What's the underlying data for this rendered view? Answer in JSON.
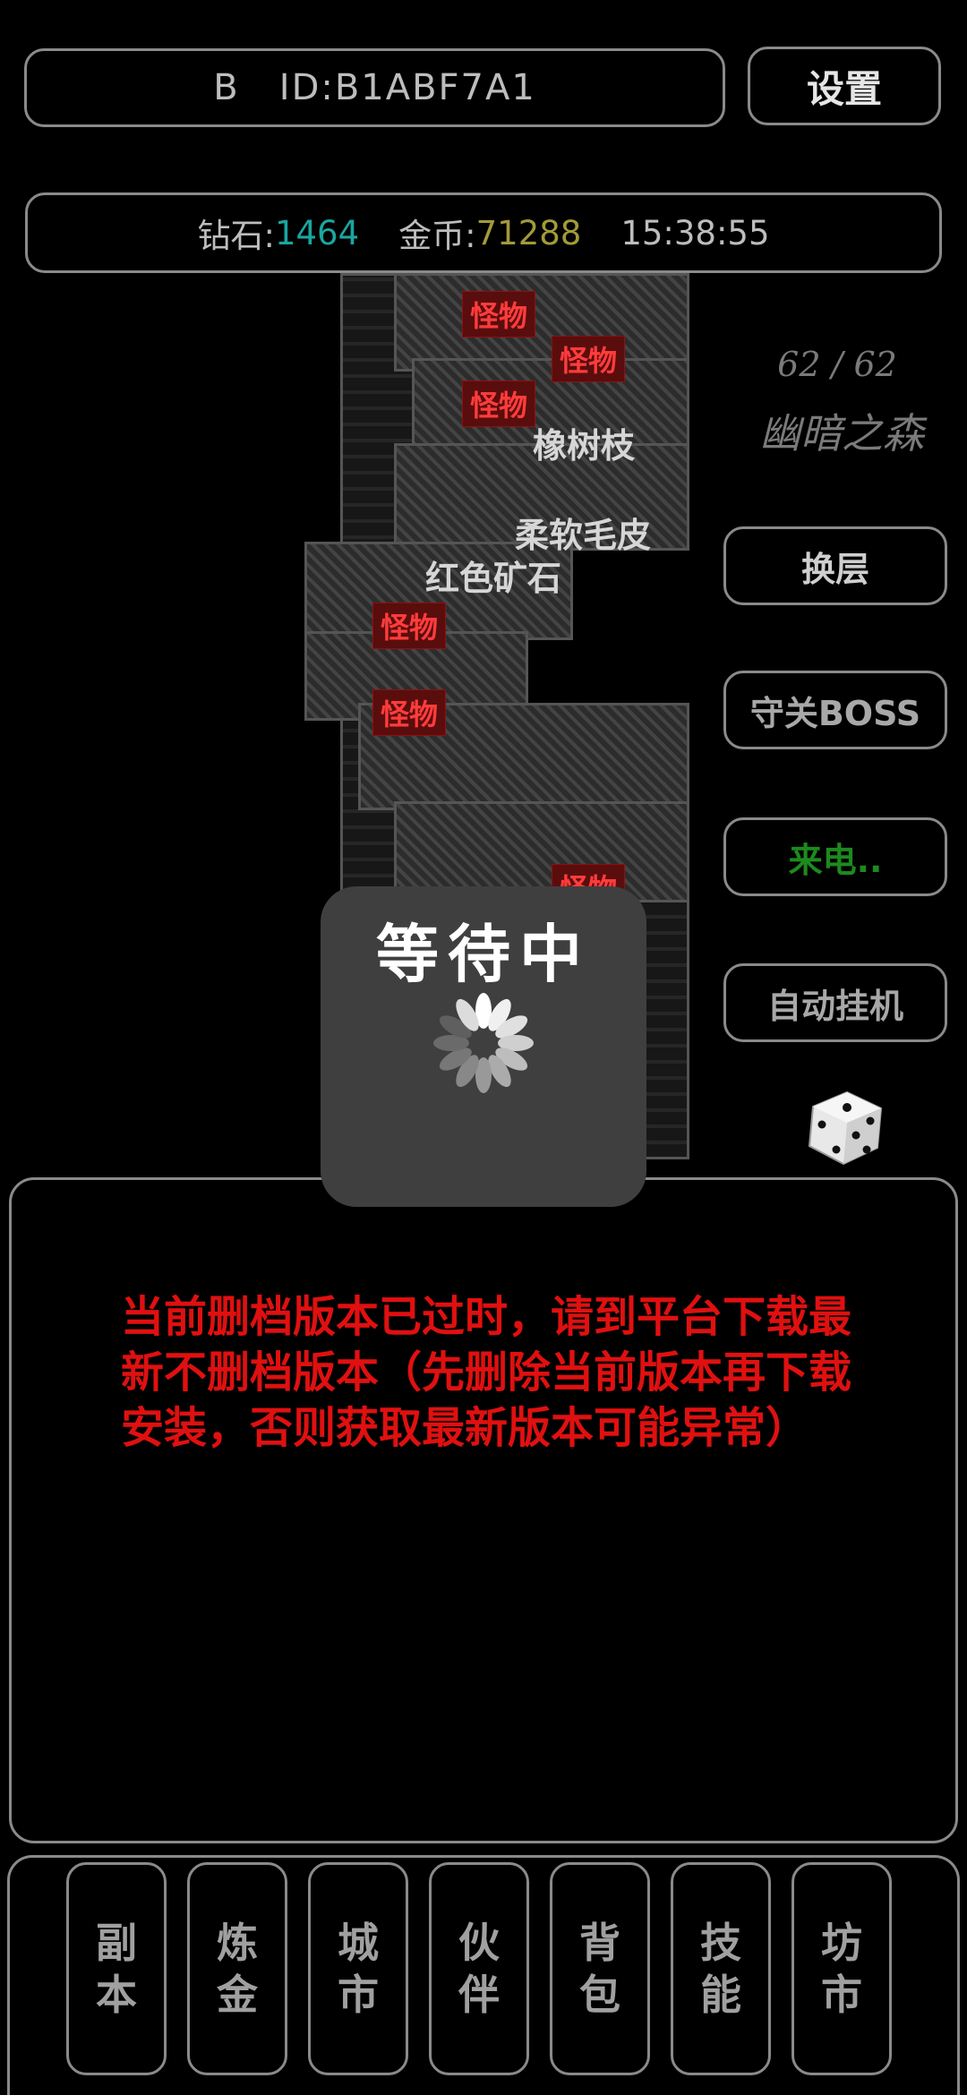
{
  "header": {
    "id_label": "B   ID:B1ABF7A1",
    "settings_label": "设置"
  },
  "status": {
    "diamond_label": "钻石:",
    "diamond_value": "1464",
    "gold_label": "金币:",
    "gold_value": "71288",
    "time": "15:38:55"
  },
  "map": {
    "monster_label": "怪物",
    "resources": [
      "橡树枝",
      "柔软毛皮",
      "红色矿石"
    ]
  },
  "floor": {
    "count": "62 / 62",
    "name": "幽暗之森"
  },
  "actions": {
    "switch_floor": "换层",
    "guard_boss": "守关BOSS",
    "incoming_call": "来电..",
    "auto_idle": "自动挂机"
  },
  "loading": {
    "title": "等待中"
  },
  "message": {
    "text": "当前删档版本已过时，请到平台下载最新不删档版本（先删除当前版本再下载安装，否则获取最新版本可能异常）"
  },
  "nav": [
    {
      "top": "副",
      "bottom": "本"
    },
    {
      "top": "炼",
      "bottom": "金"
    },
    {
      "top": "城",
      "bottom": "市"
    },
    {
      "top": "伙",
      "bottom": "伴"
    },
    {
      "top": "背",
      "bottom": "包"
    },
    {
      "top": "技",
      "bottom": "能"
    },
    {
      "top": "坊",
      "bottom": "市"
    }
  ],
  "colors": {
    "diamond": "#1aa6a0",
    "gold": "#a29a3a",
    "warning": "#e01010",
    "call": "#1d8a1d"
  }
}
